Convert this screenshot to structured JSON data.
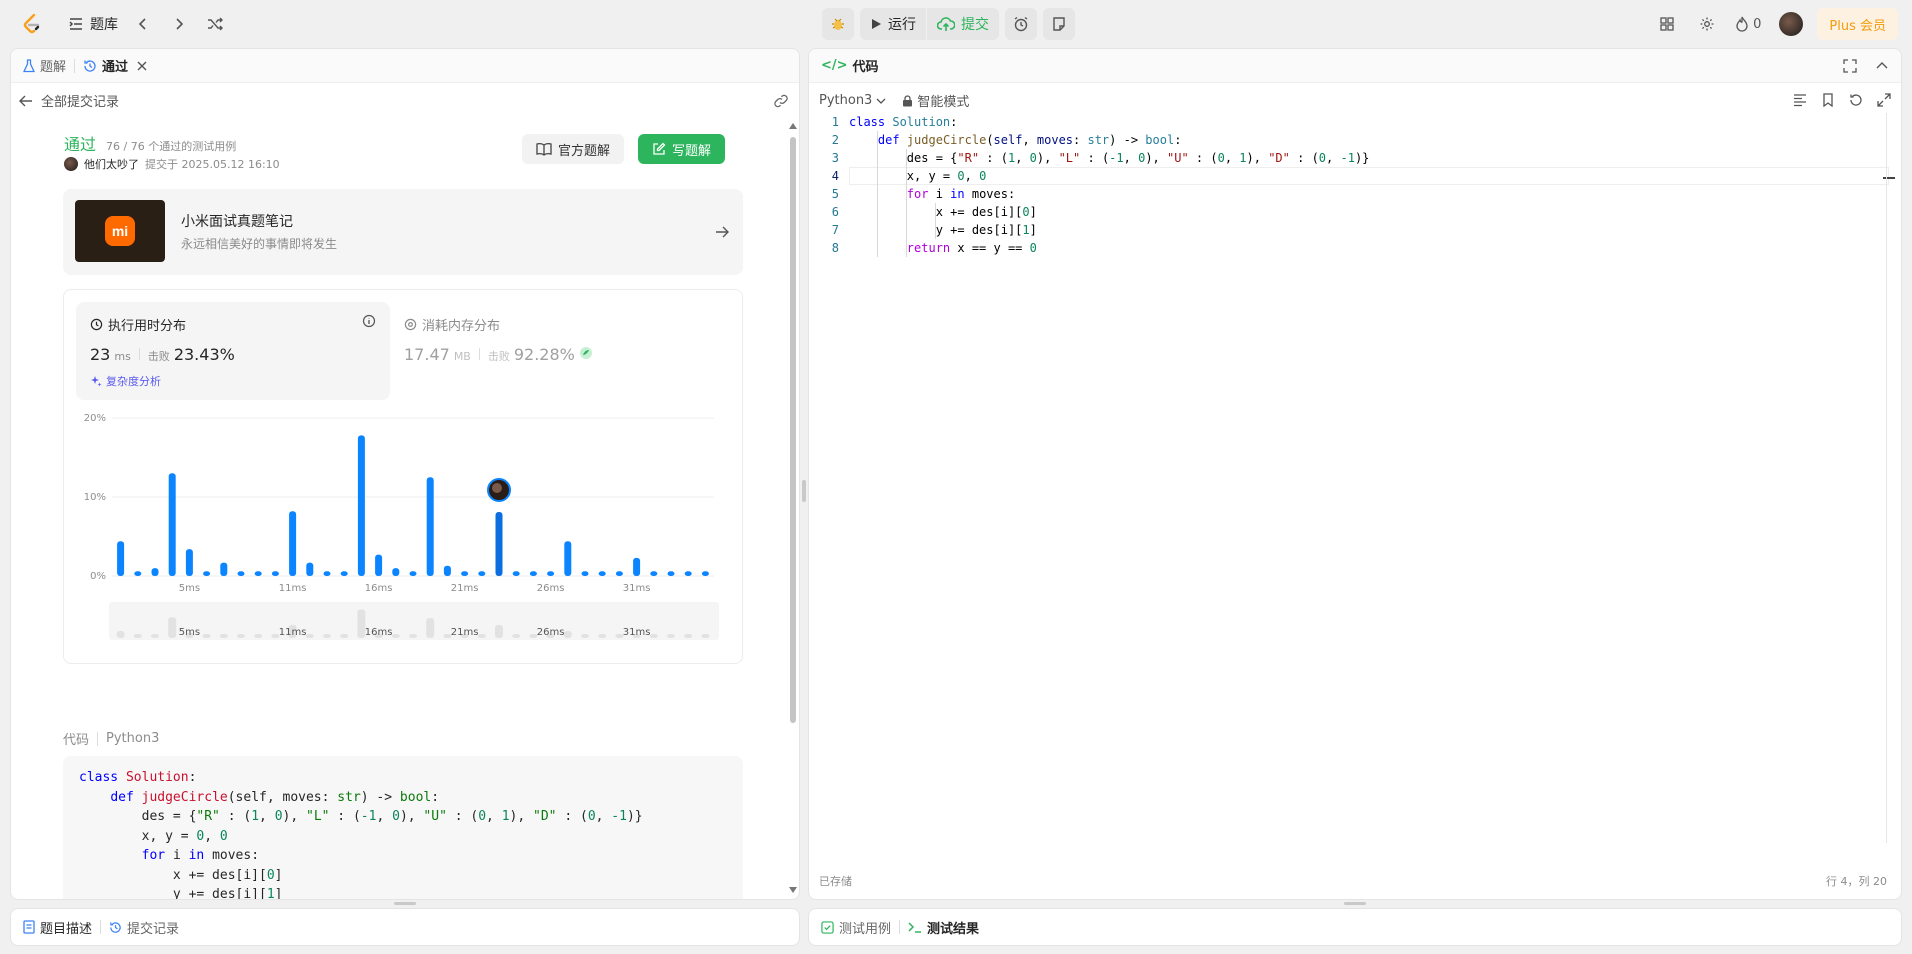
{
  "topbar": {
    "library": "题库",
    "run": "运行",
    "submit": "提交",
    "streak": "0",
    "plus": "Plus 会员"
  },
  "left_tabs": {
    "solutions": "题解",
    "accepted": "通过"
  },
  "back_link": "全部提交记录",
  "submission": {
    "status": "通过",
    "cases": "76 / 76 个通过的测试用例",
    "user": "他们太吵了",
    "submitted_at": "提交于 2025.05.12 16:10",
    "official_btn": "官方题解",
    "write_btn": "写题解"
  },
  "promo": {
    "title": "小米面试真题笔记",
    "subtitle": "永远相信美好的事情即将发生"
  },
  "runtime": {
    "label": "执行用时分布",
    "value": "23",
    "unit": "ms",
    "beats_label": "击败",
    "beats": "23.43%",
    "complexity": "复杂度分析"
  },
  "memory": {
    "label": "消耗内存分布",
    "value": "17.47",
    "unit": "MB",
    "beats_label": "击败",
    "beats": "92.28%"
  },
  "chart_data": {
    "type": "bar",
    "categories": [
      "1",
      "2",
      "3",
      "4",
      "5",
      "6",
      "7",
      "8",
      "9",
      "10",
      "11",
      "12",
      "13",
      "14",
      "15",
      "16",
      "17",
      "18",
      "19",
      "20",
      "21",
      "22",
      "23",
      "24",
      "25",
      "26",
      "27",
      "28",
      "29",
      "30",
      "31",
      "32",
      "33",
      "34",
      "35"
    ],
    "values": [
      4.4,
      0.6,
      1,
      13,
      3.4,
      0.6,
      1.7,
      0.6,
      0.6,
      0.6,
      8.2,
      1.7,
      0.6,
      0.6,
      17.8,
      2.7,
      1,
      0.6,
      12.5,
      1.3,
      0.6,
      0.6,
      8.1,
      0.6,
      0.6,
      0.6,
      4.4,
      0.6,
      0.6,
      0.6,
      2.3,
      0.6,
      0.6,
      0.6,
      0.6
    ],
    "highlight_index": 22,
    "y_ticks": [
      "20%",
      "10%",
      "0%"
    ],
    "ylim": [
      0,
      20
    ],
    "x_tick_labels": [
      "5ms",
      "11ms",
      "16ms",
      "21ms",
      "26ms",
      "31ms"
    ],
    "x_tick_positions": [
      5,
      11,
      16,
      21,
      26,
      31
    ],
    "bar_color": "#0a84ff",
    "grid": true
  },
  "code_section": {
    "label": "代码",
    "lang": "Python3"
  },
  "editor": {
    "tab": "代码",
    "lang": "Python3",
    "mode": "智能模式",
    "saved": "已存储",
    "position": "行 4，列 20"
  },
  "code_lines": [
    "class Solution:",
    "    def judgeCircle(self, moves: str) -> bool:",
    "        des = {\"R\" : (1, 0), \"L\" : (-1, 0), \"U\" : (0, 1), \"D\" : (0, -1)}",
    "        x, y = 0, 0",
    "        for i in moves:",
    "            x += des[i][0]",
    "            y += des[i][1]",
    "        return x == y == 0"
  ],
  "line_numbers": [
    "1",
    "2",
    "3",
    "4",
    "5",
    "6",
    "7",
    "8"
  ],
  "bottom_left": {
    "desc": "题目描述",
    "records": "提交记录"
  },
  "bottom_right": {
    "testcase": "测试用例",
    "result": "测试结果"
  }
}
